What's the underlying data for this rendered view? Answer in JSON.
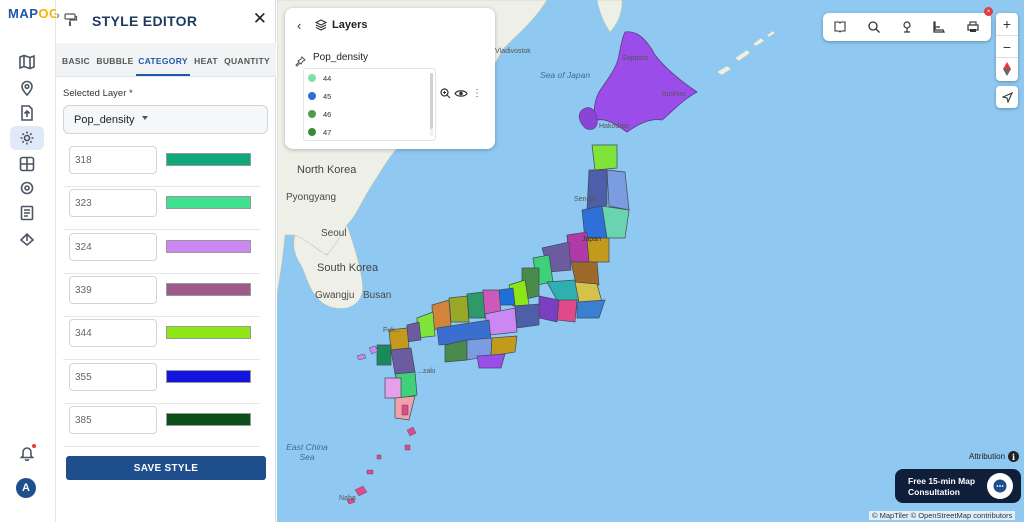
{
  "brand": {
    "logo_text_a": "MAP",
    "logo_text_b": "OG"
  },
  "rail": {
    "icons": [
      "map-icon",
      "location-pin-icon",
      "upload-icon",
      "gear-icon",
      "layers-group-icon",
      "settings-icon",
      "report-icon",
      "share-icon"
    ],
    "active_index": 3,
    "avatar_letter": "A"
  },
  "editor": {
    "title": "STYLE EDITOR",
    "tabs": [
      "BASIC",
      "BUBBLE",
      "CATEGORY",
      "HEAT",
      "QUANTITY"
    ],
    "active_tab": "CATEGORY",
    "selected_layer_label": "Selected Layer *",
    "selected_layer_value": "Pop_density",
    "categories": [
      {
        "value": "318",
        "color": "#0fa77c"
      },
      {
        "value": "323",
        "color": "#3fe08f"
      },
      {
        "value": "324",
        "color": "#cc88f2"
      },
      {
        "value": "339",
        "color": "#9e5a8b"
      },
      {
        "value": "344",
        "color": "#8ee617"
      },
      {
        "value": "355",
        "color": "#1414e0"
      },
      {
        "value": "385",
        "color": "#0e5018"
      }
    ],
    "save_label": "SAVE STYLE"
  },
  "layers_panel": {
    "title": "Layers",
    "layer_name": "Pop_density",
    "legend": [
      {
        "label": "44",
        "color": "#7fe0a8"
      },
      {
        "label": "45",
        "color": "#2a6fd6"
      },
      {
        "label": "46",
        "color": "#4b9e4b"
      },
      {
        "label": "47",
        "color": "#3c8a3c"
      }
    ]
  },
  "map": {
    "labels": {
      "sea_of_japan": "Sea of Japan",
      "north_korea": "North Korea",
      "pyongyang": "Pyongyang",
      "seoul": "Seoul",
      "south_korea": "South Korea",
      "busan": "Busan",
      "gwangju": "Gwangju",
      "east_china_sea": "East China Sea",
      "sapporo": "Sapporo",
      "kushiro": "Kushiro",
      "hakodate": "Hakodate",
      "sendai": "Sendai",
      "japan": "Japan",
      "vladivostok": "Vladivostok",
      "fukuoka": "Fuk...",
      "kagoshima": "...zaki",
      "naha": "Naha"
    },
    "attribution": "Attribution",
    "copyright": "© MapTiler © OpenStreetMap contributors",
    "consult_line1": "Free 15-min Map",
    "consult_line2": "Consultation"
  },
  "toolbar": {
    "icons": [
      "book-map-icon",
      "search-icon",
      "pin-icon",
      "boot-icon",
      "print-icon"
    ],
    "badge": "×"
  },
  "zoom": {
    "in": "+",
    "out": "−"
  }
}
